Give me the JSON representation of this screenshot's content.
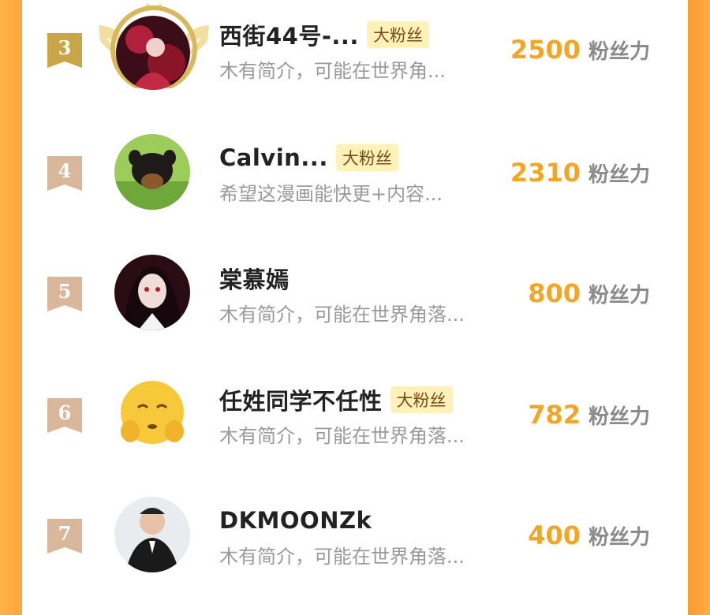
{
  "colors": {
    "accent": "#f5a524",
    "badge_bg": "#fff1b8",
    "side": "#ffa63a",
    "ribbon": "#d9b79a"
  },
  "rows": [
    {
      "rank": "3",
      "name": "西街44号-...",
      "badge": "大粉丝",
      "bio": "木有简介，可能在世界角...",
      "score": "2500",
      "unit": "粉丝力"
    },
    {
      "rank": "4",
      "name": "Calvin...",
      "badge": "大粉丝",
      "bio": "希望这漫画能快更+内容...",
      "score": "2310",
      "unit": "粉丝力"
    },
    {
      "rank": "5",
      "name": "棠慕嫣",
      "badge": "",
      "bio": "木有简介，可能在世界角落...",
      "score": "800",
      "unit": "粉丝力"
    },
    {
      "rank": "6",
      "name": "任姓同学不任性",
      "badge": "大粉丝",
      "bio": "木有简介，可能在世界角落...",
      "score": "782",
      "unit": "粉丝力"
    },
    {
      "rank": "7",
      "name": "DKMOONZk",
      "badge": "",
      "bio": "木有简介，可能在世界角落...",
      "score": "400",
      "unit": "粉丝力"
    }
  ]
}
